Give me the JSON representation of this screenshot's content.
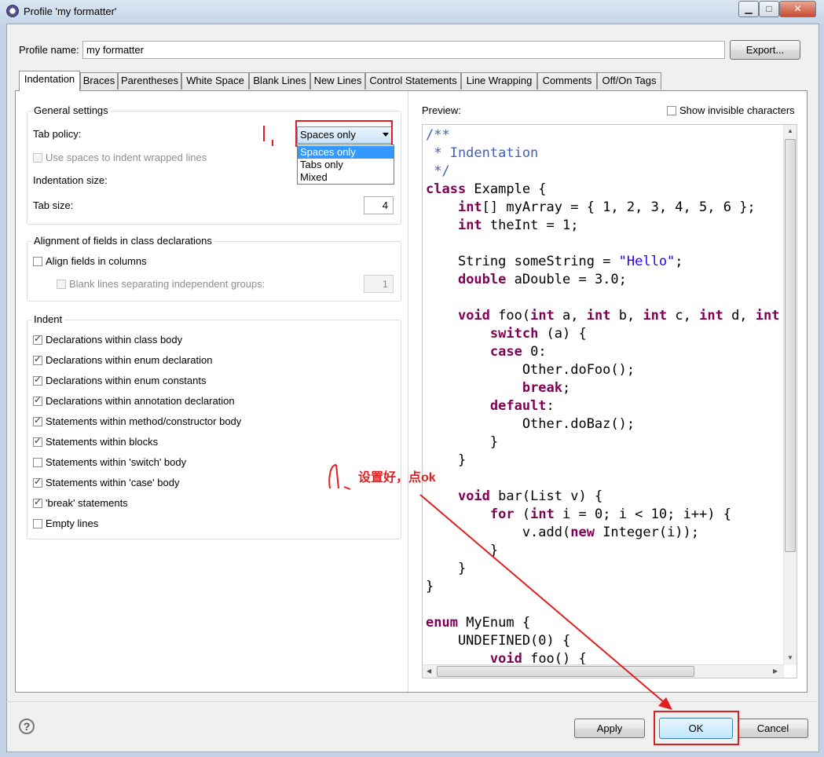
{
  "window": {
    "title": "Profile 'my formatter'",
    "minimize": "▁",
    "maximize": "□",
    "close": "✕"
  },
  "profile": {
    "name_label": "Profile name:",
    "name_value": "my formatter",
    "export_button": "Export..."
  },
  "tabs": [
    {
      "label": "Indentation",
      "active": true
    },
    {
      "label": "Braces"
    },
    {
      "label": "Parentheses"
    },
    {
      "label": "White Space"
    },
    {
      "label": "Blank Lines"
    },
    {
      "label": "New Lines"
    },
    {
      "label": "Control Statements"
    },
    {
      "label": "Line Wrapping"
    },
    {
      "label": "Comments"
    },
    {
      "label": "Off/On Tags"
    }
  ],
  "general": {
    "title": "General settings",
    "tab_policy_label": "Tab policy:",
    "tab_policy_value": "Spaces only",
    "tab_policy_options": [
      "Spaces only",
      "Tabs only",
      "Mixed"
    ],
    "use_spaces_label": "Use spaces to indent wrapped lines",
    "indent_size_label": "Indentation size:",
    "tab_size_label": "Tab size:",
    "tab_size_value": "4"
  },
  "alignment": {
    "title": "Alignment of fields in class declarations",
    "align_label": "Align fields in columns",
    "blank_lines_label": "Blank lines separating independent groups:",
    "blank_lines_value": "1"
  },
  "indent": {
    "title": "Indent",
    "items": [
      {
        "label": "Declarations within class body",
        "checked": true
      },
      {
        "label": "Declarations within enum declaration",
        "checked": true
      },
      {
        "label": "Declarations within enum constants",
        "checked": true
      },
      {
        "label": "Declarations within annotation declaration",
        "checked": true
      },
      {
        "label": "Statements within method/constructor body",
        "checked": true
      },
      {
        "label": "Statements within blocks",
        "checked": true
      },
      {
        "label": "Statements within 'switch' body",
        "checked": false
      },
      {
        "label": "Statements within 'case' body",
        "checked": true
      },
      {
        "label": "'break' statements",
        "checked": true
      },
      {
        "label": "Empty lines",
        "checked": false
      }
    ]
  },
  "preview": {
    "label": "Preview:",
    "show_invisible_label": "Show invisible characters"
  },
  "buttons": {
    "apply": "Apply",
    "ok": "OK",
    "cancel": "Cancel",
    "help": "?"
  },
  "annotation": {
    "text": "设置好，点ok",
    "color": "#e02020"
  }
}
